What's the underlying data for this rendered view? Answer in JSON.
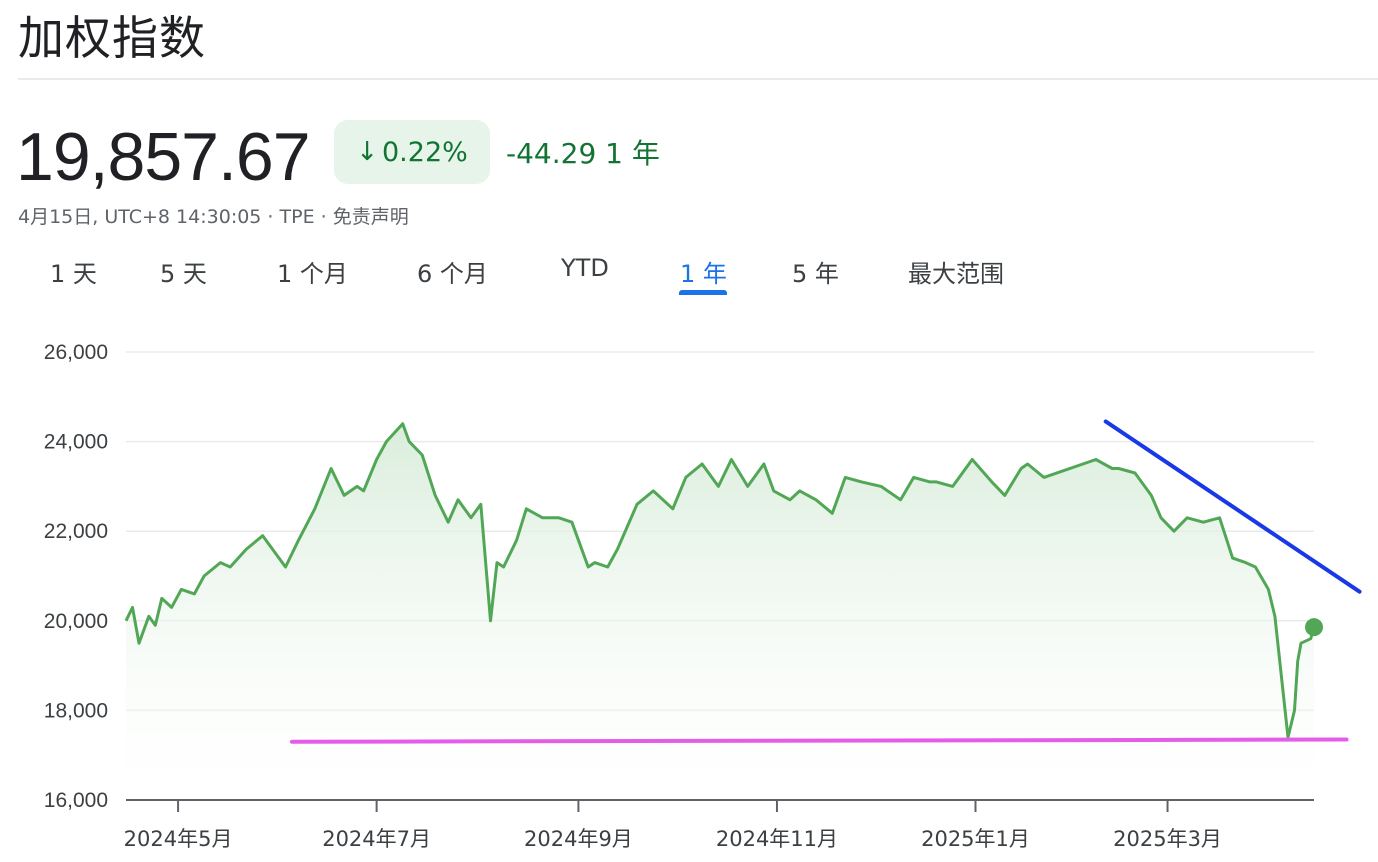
{
  "header": {
    "title": "加权指数",
    "price": "19,857.67",
    "change_pct": "0.22%",
    "change_abs": "-44.29 1 年",
    "meta": "4月15日, UTC+8 14:30:05 · TPE · 免责声明"
  },
  "tabs": [
    "1 天",
    "5 天",
    "1 个月",
    "6 个月",
    "YTD",
    "1 年",
    "5 年",
    "最大范围"
  ],
  "active_tab": "1 年",
  "colors": {
    "line": "#52a756",
    "fill": "#e6f4ea",
    "positive_text": "#137333",
    "accent": "#1a73e8",
    "annotation_blue": "#1a39e6",
    "annotation_magenta": "#e55ce8"
  },
  "icons": {
    "change_arrow": "arrow-down-icon"
  },
  "chart_data": {
    "type": "area",
    "title": "",
    "xlabel": "",
    "ylabel": "",
    "ylim": [
      16000,
      26000
    ],
    "yticks": [
      16000,
      18000,
      20000,
      22000,
      24000,
      26000
    ],
    "ytick_labels": [
      "16,000",
      "18,000",
      "20,000",
      "22,000",
      "24,000",
      "26,000"
    ],
    "xtick_labels": [
      "2024年5月",
      "2024年7月",
      "2024年9月",
      "2024年11月",
      "2025年1月",
      "2025年3月"
    ],
    "grid": true,
    "x": [
      "2024-04-15",
      "2024-04-17",
      "2024-04-19",
      "2024-04-22",
      "2024-04-24",
      "2024-04-26",
      "2024-04-29",
      "2024-05-02",
      "2024-05-06",
      "2024-05-09",
      "2024-05-14",
      "2024-05-17",
      "2024-05-22",
      "2024-05-27",
      "2024-06-03",
      "2024-06-07",
      "2024-06-12",
      "2024-06-17",
      "2024-06-21",
      "2024-06-25",
      "2024-06-27",
      "2024-07-01",
      "2024-07-04",
      "2024-07-09",
      "2024-07-11",
      "2024-07-15",
      "2024-07-19",
      "2024-07-23",
      "2024-07-26",
      "2024-07-30",
      "2024-08-02",
      "2024-08-05",
      "2024-08-07",
      "2024-08-09",
      "2024-08-13",
      "2024-08-16",
      "2024-08-21",
      "2024-08-26",
      "2024-08-30",
      "2024-09-04",
      "2024-09-06",
      "2024-09-10",
      "2024-09-13",
      "2024-09-19",
      "2024-09-24",
      "2024-09-30",
      "2024-10-04",
      "2024-10-09",
      "2024-10-14",
      "2024-10-18",
      "2024-10-23",
      "2024-10-28",
      "2024-10-31",
      "2024-11-05",
      "2024-11-08",
      "2024-11-13",
      "2024-11-18",
      "2024-11-22",
      "2024-11-27",
      "2024-12-03",
      "2024-12-09",
      "2024-12-13",
      "2024-12-18",
      "2024-12-20",
      "2024-12-25",
      "2024-12-31",
      "2025-01-06",
      "2025-01-10",
      "2025-01-15",
      "2025-01-17",
      "2025-01-22",
      "2025-02-03",
      "2025-02-07",
      "2025-02-12",
      "2025-02-14",
      "2025-02-19",
      "2025-02-24",
      "2025-02-27",
      "2025-03-03",
      "2025-03-07",
      "2025-03-12",
      "2025-03-17",
      "2025-03-21",
      "2025-03-25",
      "2025-03-28",
      "2025-04-01",
      "2025-04-03",
      "2025-04-07",
      "2025-04-09",
      "2025-04-10",
      "2025-04-11",
      "2025-04-14",
      "2025-04-15"
    ],
    "series": [
      {
        "values": [
          20000,
          20300,
          19500,
          20100,
          19900,
          20500,
          20300,
          20700,
          20600,
          21000,
          21300,
          21200,
          21600,
          21900,
          21200,
          21800,
          22500,
          23400,
          22800,
          23000,
          22900,
          23600,
          24000,
          24400,
          24000,
          23700,
          22800,
          22200,
          22700,
          22300,
          22600,
          20000,
          21300,
          21200,
          21800,
          22500,
          22300,
          22300,
          22200,
          21200,
          21300,
          21200,
          21600,
          22600,
          22900,
          22500,
          23200,
          23500,
          23000,
          23600,
          23000,
          23500,
          22900,
          22700,
          22900,
          22700,
          22400,
          23200,
          23100,
          23000,
          22700,
          23200,
          23100,
          23100,
          23000,
          23600,
          23100,
          22800,
          23400,
          23500,
          23200,
          23500,
          23600,
          23400,
          23400,
          23300,
          22800,
          22300,
          22000,
          22300,
          22200,
          22300,
          21400,
          21300,
          21200,
          20700,
          20100,
          17400,
          18000,
          19100,
          19500,
          19600,
          19857.67
        ]
      }
    ],
    "annotations": [
      {
        "type": "trendline",
        "color": "#1a39e6",
        "from": [
          "2025-02-10",
          24450
        ],
        "to": [
          "2025-04-29",
          20650
        ]
      },
      {
        "type": "support-line",
        "color": "#e55ce8",
        "from": [
          "2024-06-05",
          17300
        ],
        "to": [
          "2025-04-25",
          17350
        ]
      }
    ]
  }
}
